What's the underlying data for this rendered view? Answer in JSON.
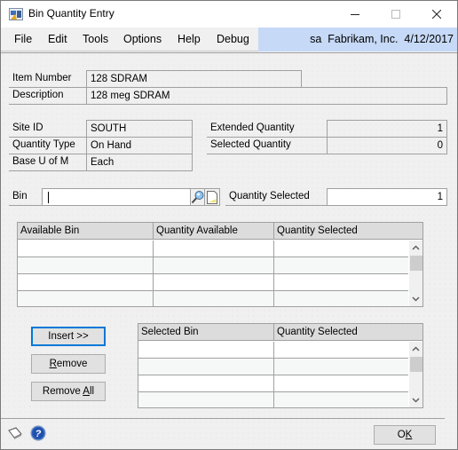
{
  "window": {
    "title": "Bin Quantity Entry",
    "icon": "app-window-icon",
    "controls": {
      "minimize": "minimize",
      "maximize": "maximize",
      "close": "close"
    }
  },
  "menu": {
    "items": [
      "File",
      "Edit",
      "Tools",
      "Options",
      "Help",
      "Debug"
    ],
    "status": {
      "user": "sa",
      "company": "Fabrikam, Inc.",
      "date": "4/12/2017",
      "text": "sa  Fabrikam, Inc.  4/12/2017"
    }
  },
  "item": {
    "number_label": "Item Number",
    "number_value": "128 SDRAM",
    "description_label": "Description",
    "description_value": "128 meg SDRAM"
  },
  "site": {
    "site_id_label": "Site ID",
    "site_id_value": "SOUTH",
    "quantity_type_label": "Quantity Type",
    "quantity_type_value": "On Hand",
    "base_uofm_label": "Base U of M",
    "base_uofm_value": "Each"
  },
  "quantities": {
    "extended_label": "Extended Quantity",
    "extended_value": "1",
    "selected_label": "Selected Quantity",
    "selected_value": "0"
  },
  "bin_entry": {
    "bin_label": "Bin",
    "bin_value": "",
    "lookup_icon": "magnifier-lookup-icon",
    "note_icon": "note-icon",
    "qty_selected_label": "Quantity Selected",
    "qty_selected_value": "1"
  },
  "available_grid": {
    "columns": [
      "Available Bin",
      "Quantity Available",
      "Quantity Selected"
    ],
    "rows": [
      [
        "",
        "",
        ""
      ],
      [
        "",
        "",
        ""
      ],
      [
        "",
        "",
        ""
      ],
      [
        "",
        "",
        ""
      ]
    ]
  },
  "selected_grid": {
    "columns": [
      "Selected Bin",
      "Quantity Selected"
    ],
    "rows": [
      [
        "",
        ""
      ],
      [
        "",
        ""
      ],
      [
        "",
        ""
      ],
      [
        "",
        ""
      ]
    ]
  },
  "buttons": {
    "insert": "Insert >>",
    "remove_pre": "",
    "remove_u": "R",
    "remove_post": "emove",
    "remove_all_pre": "Remove ",
    "remove_all_u": "A",
    "remove_all_post": "ll",
    "ok_pre": "O",
    "ok_u": "K"
  },
  "footer": {
    "note_icon": "window-note-icon",
    "help_icon": "help-icon"
  }
}
